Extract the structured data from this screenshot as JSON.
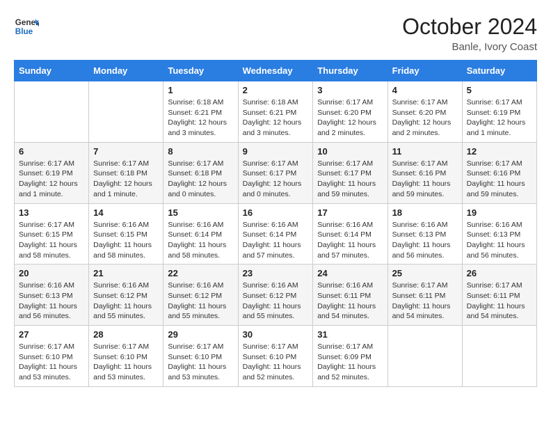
{
  "header": {
    "logo_line1": "General",
    "logo_line2": "Blue",
    "month_year": "October 2024",
    "location": "Banle, Ivory Coast"
  },
  "weekdays": [
    "Sunday",
    "Monday",
    "Tuesday",
    "Wednesday",
    "Thursday",
    "Friday",
    "Saturday"
  ],
  "weeks": [
    [
      {
        "day": "",
        "detail": ""
      },
      {
        "day": "",
        "detail": ""
      },
      {
        "day": "1",
        "detail": "Sunrise: 6:18 AM\nSunset: 6:21 PM\nDaylight: 12 hours and 3 minutes."
      },
      {
        "day": "2",
        "detail": "Sunrise: 6:18 AM\nSunset: 6:21 PM\nDaylight: 12 hours and 3 minutes."
      },
      {
        "day": "3",
        "detail": "Sunrise: 6:17 AM\nSunset: 6:20 PM\nDaylight: 12 hours and 2 minutes."
      },
      {
        "day": "4",
        "detail": "Sunrise: 6:17 AM\nSunset: 6:20 PM\nDaylight: 12 hours and 2 minutes."
      },
      {
        "day": "5",
        "detail": "Sunrise: 6:17 AM\nSunset: 6:19 PM\nDaylight: 12 hours and 1 minute."
      }
    ],
    [
      {
        "day": "6",
        "detail": "Sunrise: 6:17 AM\nSunset: 6:19 PM\nDaylight: 12 hours and 1 minute."
      },
      {
        "day": "7",
        "detail": "Sunrise: 6:17 AM\nSunset: 6:18 PM\nDaylight: 12 hours and 1 minute."
      },
      {
        "day": "8",
        "detail": "Sunrise: 6:17 AM\nSunset: 6:18 PM\nDaylight: 12 hours and 0 minutes."
      },
      {
        "day": "9",
        "detail": "Sunrise: 6:17 AM\nSunset: 6:17 PM\nDaylight: 12 hours and 0 minutes."
      },
      {
        "day": "10",
        "detail": "Sunrise: 6:17 AM\nSunset: 6:17 PM\nDaylight: 11 hours and 59 minutes."
      },
      {
        "day": "11",
        "detail": "Sunrise: 6:17 AM\nSunset: 6:16 PM\nDaylight: 11 hours and 59 minutes."
      },
      {
        "day": "12",
        "detail": "Sunrise: 6:17 AM\nSunset: 6:16 PM\nDaylight: 11 hours and 59 minutes."
      }
    ],
    [
      {
        "day": "13",
        "detail": "Sunrise: 6:17 AM\nSunset: 6:15 PM\nDaylight: 11 hours and 58 minutes."
      },
      {
        "day": "14",
        "detail": "Sunrise: 6:16 AM\nSunset: 6:15 PM\nDaylight: 11 hours and 58 minutes."
      },
      {
        "day": "15",
        "detail": "Sunrise: 6:16 AM\nSunset: 6:14 PM\nDaylight: 11 hours and 58 minutes."
      },
      {
        "day": "16",
        "detail": "Sunrise: 6:16 AM\nSunset: 6:14 PM\nDaylight: 11 hours and 57 minutes."
      },
      {
        "day": "17",
        "detail": "Sunrise: 6:16 AM\nSunset: 6:14 PM\nDaylight: 11 hours and 57 minutes."
      },
      {
        "day": "18",
        "detail": "Sunrise: 6:16 AM\nSunset: 6:13 PM\nDaylight: 11 hours and 56 minutes."
      },
      {
        "day": "19",
        "detail": "Sunrise: 6:16 AM\nSunset: 6:13 PM\nDaylight: 11 hours and 56 minutes."
      }
    ],
    [
      {
        "day": "20",
        "detail": "Sunrise: 6:16 AM\nSunset: 6:13 PM\nDaylight: 11 hours and 56 minutes."
      },
      {
        "day": "21",
        "detail": "Sunrise: 6:16 AM\nSunset: 6:12 PM\nDaylight: 11 hours and 55 minutes."
      },
      {
        "day": "22",
        "detail": "Sunrise: 6:16 AM\nSunset: 6:12 PM\nDaylight: 11 hours and 55 minutes."
      },
      {
        "day": "23",
        "detail": "Sunrise: 6:16 AM\nSunset: 6:12 PM\nDaylight: 11 hours and 55 minutes."
      },
      {
        "day": "24",
        "detail": "Sunrise: 6:16 AM\nSunset: 6:11 PM\nDaylight: 11 hours and 54 minutes."
      },
      {
        "day": "25",
        "detail": "Sunrise: 6:17 AM\nSunset: 6:11 PM\nDaylight: 11 hours and 54 minutes."
      },
      {
        "day": "26",
        "detail": "Sunrise: 6:17 AM\nSunset: 6:11 PM\nDaylight: 11 hours and 54 minutes."
      }
    ],
    [
      {
        "day": "27",
        "detail": "Sunrise: 6:17 AM\nSunset: 6:10 PM\nDaylight: 11 hours and 53 minutes."
      },
      {
        "day": "28",
        "detail": "Sunrise: 6:17 AM\nSunset: 6:10 PM\nDaylight: 11 hours and 53 minutes."
      },
      {
        "day": "29",
        "detail": "Sunrise: 6:17 AM\nSunset: 6:10 PM\nDaylight: 11 hours and 53 minutes."
      },
      {
        "day": "30",
        "detail": "Sunrise: 6:17 AM\nSunset: 6:10 PM\nDaylight: 11 hours and 52 minutes."
      },
      {
        "day": "31",
        "detail": "Sunrise: 6:17 AM\nSunset: 6:09 PM\nDaylight: 11 hours and 52 minutes."
      },
      {
        "day": "",
        "detail": ""
      },
      {
        "day": "",
        "detail": ""
      }
    ]
  ]
}
